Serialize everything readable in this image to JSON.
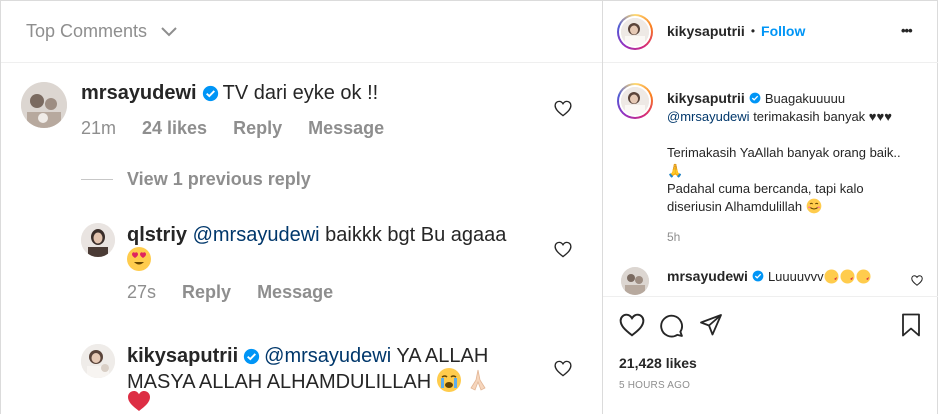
{
  "left": {
    "top_comments_label": "Top Comments",
    "view_previous_reply": "View 1 previous reply",
    "comments": [
      {
        "username": "mrsayudewi",
        "text": "TV dari eyke ok !!",
        "time": "21m",
        "likes": "24 likes",
        "reply": "Reply",
        "message": "Message"
      },
      {
        "username": "qlstriy",
        "mention": "@mrsayudewi",
        "text": "baikkk bgt Bu agaaa",
        "time": "27s",
        "reply": "Reply",
        "message": "Message"
      },
      {
        "username": "kikysaputrii",
        "mention": "@mrsayudewi",
        "text_line1": "YA ALLAH",
        "text_line2": "MASYA ALLAH ALHAMDULILLAH"
      }
    ]
  },
  "right": {
    "header": {
      "username": "kikysaputrii",
      "dot": "•",
      "follow": "Follow",
      "more": "•••"
    },
    "caption": {
      "username": "kikysaputrii",
      "line1": "Buagakuuuuu",
      "mention": "@mrsayudewi",
      "line2": "terimakasih banyak ♥♥♥",
      "line3": "Terimakasih YaAllah banyak orang baik..",
      "line4": "🙏",
      "line5": "Padahal cuma bercanda, tapi kalo",
      "line6": "diseriusin Alhamdulillah",
      "time": "5h"
    },
    "comment": {
      "username": "mrsayudewi",
      "text": "Luuuuvvv"
    },
    "likes": "21,428 likes",
    "posted": "5 HOURS AGO"
  },
  "colors": {
    "verified": "#0095f6",
    "follow": "#0095f6",
    "mention": "#00376b",
    "muted": "#8e8e8e"
  }
}
